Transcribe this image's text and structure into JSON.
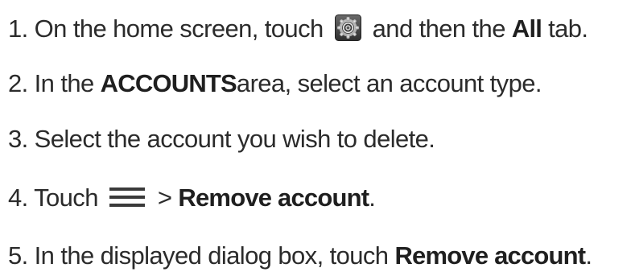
{
  "steps": [
    {
      "number": "1.",
      "text_before_icon": "On the home screen, touch",
      "icon": "settings-gear-icon",
      "text_after_icon": "and then the",
      "bold": "All",
      "text_end": "tab."
    },
    {
      "number": "2.",
      "text_before": "In the",
      "bold": "ACCOUNTS",
      "text_after": "area, select an account type."
    },
    {
      "number": "3.",
      "text": "Select the account you wish to delete."
    },
    {
      "number": "4.",
      "text_before_icon": "Touch",
      "icon": "menu-icon",
      "text_after_icon": ">",
      "bold": "Remove account",
      "text_end": "."
    },
    {
      "number": "5.",
      "text_before": "In the displayed dialog box, touch",
      "bold": "Remove account",
      "text_end": "."
    }
  ],
  "colors": {
    "text": "#2b2b2b",
    "bold_text": "#1f1f1f",
    "icon_bg": "#4a4a4a"
  }
}
